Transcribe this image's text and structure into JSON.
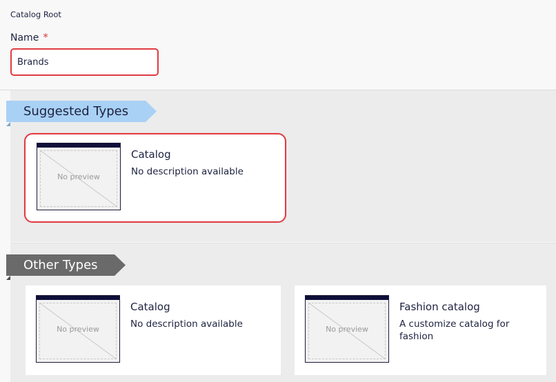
{
  "header": {
    "breadcrumb": "Catalog Root",
    "name_label": "Name",
    "required_mark": "*",
    "name_value": "Brands"
  },
  "suggested": {
    "title": "Suggested Types",
    "cards": [
      {
        "title": "Catalog",
        "description": "No description available",
        "preview_text": "No preview"
      }
    ]
  },
  "other": {
    "title": "Other Types",
    "cards": [
      {
        "title": "Catalog",
        "description": "No description available",
        "preview_text": "No preview"
      },
      {
        "title": "Fashion catalog",
        "description": "A customize catalog for fashion",
        "preview_text": "No preview"
      }
    ]
  },
  "colors": {
    "accent_red": "#e03b42",
    "ribbon_blue": "#a9d1f5",
    "ribbon_grey": "#6a6a6a",
    "text_dark": "#1d2240"
  }
}
